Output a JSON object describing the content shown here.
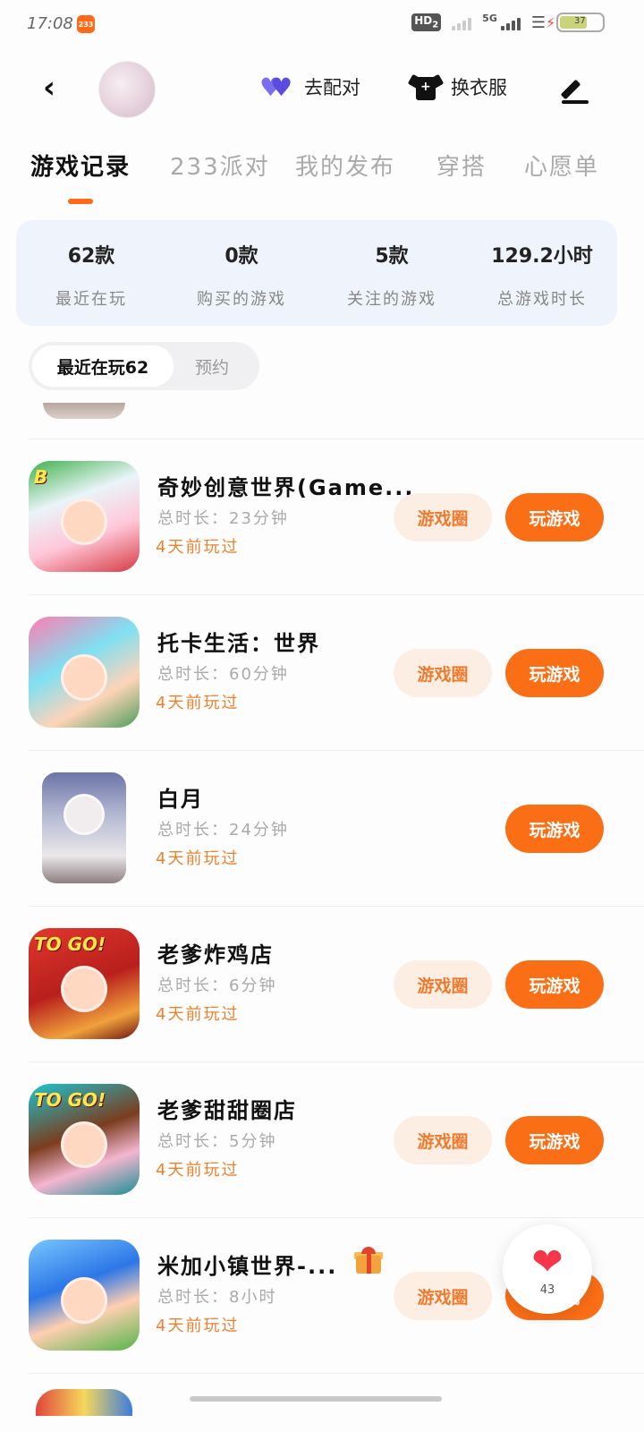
{
  "status": {
    "time": "17:08",
    "app_badge": "233",
    "hd": "HD",
    "hd_sub": "2",
    "network": "5G",
    "battery": "37"
  },
  "header": {
    "pair_label": "去配对",
    "dress_label": "换衣服"
  },
  "tabs": [
    "游戏记录",
    "233派对",
    "我的发布",
    "穿搭",
    "心愿单"
  ],
  "stats": [
    {
      "value": "62款",
      "label": "最近在玩"
    },
    {
      "value": "0款",
      "label": "购买的游戏"
    },
    {
      "value": "5款",
      "label": "关注的游戏"
    },
    {
      "value": "129.2小时",
      "label": "总游戏时长"
    }
  ],
  "filters": {
    "active": "最近在玩62",
    "other": "预约"
  },
  "games": [
    {
      "title": "奇妙创意世界(Game...",
      "duration": "总时长：23分钟",
      "last_played": "4天前玩过",
      "circle_label": "游戏圈",
      "play_label": "玩游戏",
      "icon_text": "B"
    },
    {
      "title": "托卡生活：世界",
      "duration": "总时长：60分钟",
      "last_played": "4天前玩过",
      "circle_label": "游戏圈",
      "play_label": "玩游戏",
      "icon_text": ""
    },
    {
      "title": "白月",
      "duration": "总时长：24分钟",
      "last_played": "4天前玩过",
      "circle_label": "",
      "play_label": "玩游戏",
      "icon_text": ""
    },
    {
      "title": "老爹炸鸡店",
      "duration": "总时长：6分钟",
      "last_played": "4天前玩过",
      "circle_label": "游戏圈",
      "play_label": "玩游戏",
      "icon_text": "TO GO!"
    },
    {
      "title": "老爹甜甜圈店",
      "duration": "总时长：5分钟",
      "last_played": "4天前玩过",
      "circle_label": "游戏圈",
      "play_label": "玩游戏",
      "icon_text": "TO GO!"
    },
    {
      "title": "米加小镇世界-...",
      "duration": "总时长：8小时",
      "last_played": "4天前玩过",
      "circle_label": "游戏圈",
      "play_label": "玩游戏",
      "icon_text": ""
    }
  ],
  "float_heart": {
    "count": "43"
  },
  "colors": {
    "accent": "#fa6e16",
    "accent_light": "#fdeee4",
    "stats_bg": "#eff3fb"
  }
}
